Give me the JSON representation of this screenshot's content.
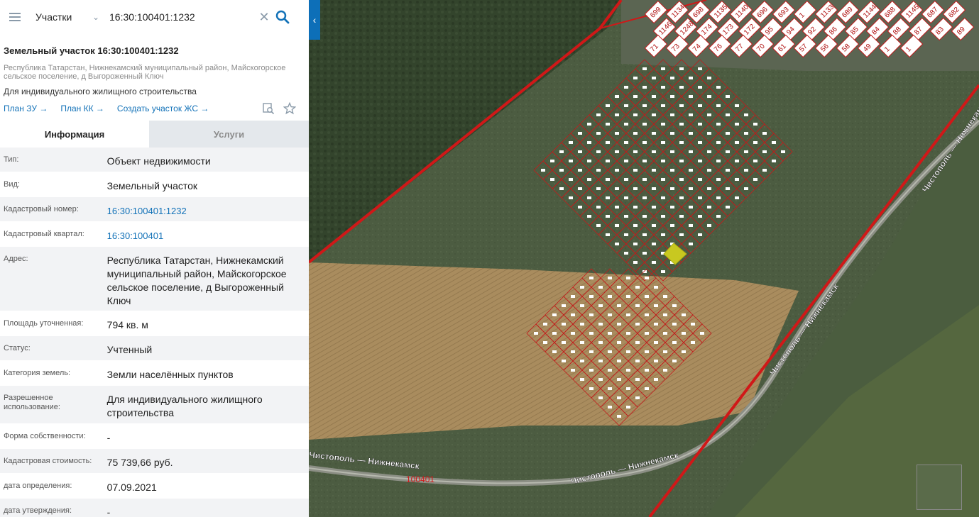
{
  "search": {
    "layer": "Участки",
    "query": "16:30:100401:1232"
  },
  "header": {
    "title": "Земельный участок 16:30:100401:1232",
    "address_small": "Республика Татарстан, Нижнекамский муниципальный район, Майскогорское сельское поселение, д Выгороженный Ключ",
    "purpose": "Для индивидуального жилищного строительства",
    "links": [
      "План ЗУ →",
      "План КК →",
      "Создать участок ЖС →"
    ]
  },
  "tabs": [
    "Информация",
    "Услуги"
  ],
  "rows": [
    {
      "label": "Тип:",
      "value": "Объект недвижимости"
    },
    {
      "label": "Вид:",
      "value": "Земельный участок"
    },
    {
      "label": "Кадастровый номер:",
      "value": "16:30:100401:1232"
    },
    {
      "label": "Кадастровый квартал:",
      "value": "16:30:100401"
    },
    {
      "label": "Адрес:",
      "value": "Республика Татарстан, Нижнекамский муниципальный район, Майскогорское сельское поселение, д Выгороженный Ключ"
    },
    {
      "label": "Площадь уточненная:",
      "value": "794 кв. м"
    },
    {
      "label": "Статус:",
      "value": "Учтенный"
    },
    {
      "label": "Категория земель:",
      "value": "Земли населённых пунктов"
    },
    {
      "label": "Разрешенное использование:",
      "value": "Для индивидуального жилищного строительства"
    },
    {
      "label": "Форма собственности:",
      "value": "-"
    },
    {
      "label": "Кадастровая стоимость:",
      "value": "75 739,66 руб."
    },
    {
      "label": "дата определения:",
      "value": "07.09.2021"
    },
    {
      "label": "дата утверждения:",
      "value": "-"
    }
  ],
  "map": {
    "road_labels": [
      "Чистополь — Нижнекамск",
      "Чистополь — Нижнекамск",
      "Чистополь — Нижнекамск",
      "Чистополь — Нижнекамск"
    ],
    "quarter_label": "100401",
    "parcel_numbers": [
      "699",
      "1134",
      "698",
      "1135",
      "1140",
      "696",
      "693",
      "1",
      "1133",
      "689",
      "1144",
      "688",
      "1145",
      "687",
      "682",
      "1146",
      "1248",
      "174",
      "173",
      "172",
      "95",
      "94",
      "92",
      "86",
      "85",
      "84",
      "88",
      "87",
      "83",
      "89",
      "71",
      "73",
      "74",
      "76",
      "77",
      "70",
      "61",
      "57",
      "56",
      "58",
      "49",
      "1",
      "1"
    ],
    "colors": {
      "forest": "#34452d",
      "field_green": "#4a5a3f",
      "field_tan": "#a88a5c",
      "boundary_red": "#d01818",
      "parcel_red": "#c21b1b",
      "selected_parcel": "#c8c820"
    }
  },
  "icons": [
    "hamburger-icon",
    "chevron-down-icon",
    "close-icon",
    "search-icon",
    "collapse-arrow-icon",
    "find-on-map-icon",
    "star-icon"
  ]
}
